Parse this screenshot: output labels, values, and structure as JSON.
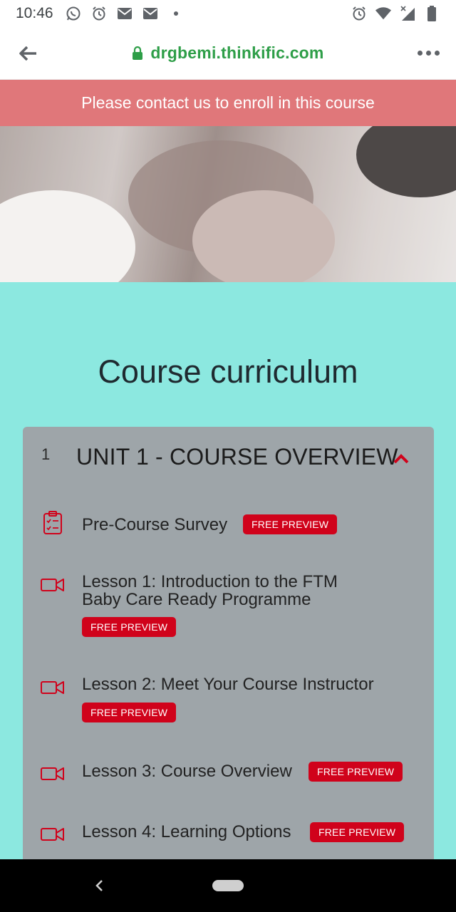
{
  "status_bar": {
    "time": "10:46",
    "left_icons": [
      "whatsapp-icon",
      "alarm-icon",
      "gmail-icon",
      "gmail-icon",
      "dot-icon"
    ],
    "right_icons": [
      "alarm-icon",
      "wifi-icon",
      "signal-icon",
      "battery-icon"
    ]
  },
  "browser": {
    "url": "drgbemi.thinkific.com",
    "secure": true,
    "accent_color": "#2e9e48"
  },
  "banner": {
    "text": "Please contact us to enroll in this course",
    "color": "#e0777a"
  },
  "curriculum": {
    "heading": "Course curriculum",
    "background": "#8ce8e0",
    "unit": {
      "number": "1",
      "title": "UNIT 1 - COURSE OVERVIEW",
      "expanded": true
    },
    "lessons": [
      {
        "icon": "survey-icon",
        "title": "Pre-Course Survey",
        "badge": "FREE PREVIEW"
      },
      {
        "icon": "video-icon",
        "title_line1": "Lesson 1: Introduction to the FTM",
        "title_line2": "Baby Care Ready Programme",
        "badge": "FREE PREVIEW"
      },
      {
        "icon": "video-icon",
        "title": "Lesson 2: Meet Your Course Instructor",
        "badge": "FREE PREVIEW"
      },
      {
        "icon": "video-icon",
        "title": "Lesson 3: Course Overview",
        "badge": "FREE PREVIEW"
      },
      {
        "icon": "video-icon",
        "title": "Lesson 4: Learning Options",
        "badge": "FREE PREVIEW"
      }
    ],
    "badge_color": "#d0021b"
  }
}
